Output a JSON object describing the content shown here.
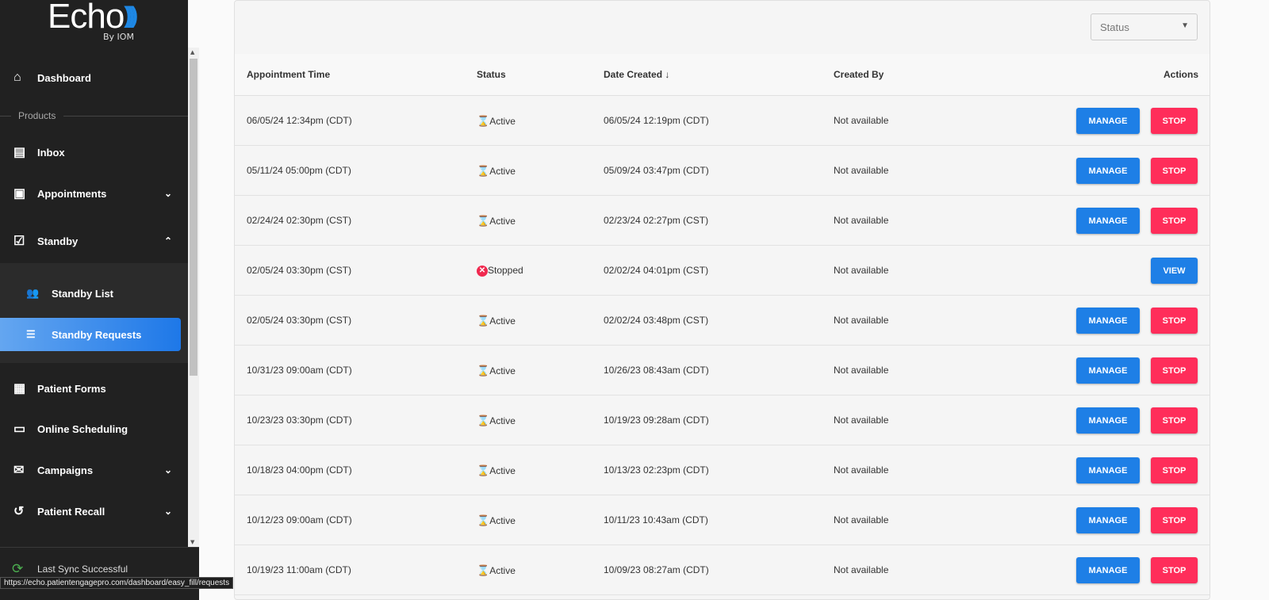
{
  "brand": {
    "name": "Echo",
    "sub": "By IOM"
  },
  "sidebar": {
    "dashboard": "Dashboard",
    "products_label": "Products",
    "items": [
      {
        "label": "Inbox"
      },
      {
        "label": "Appointments"
      },
      {
        "label": "Standby"
      },
      {
        "label": "Patient Forms"
      },
      {
        "label": "Online Scheduling"
      },
      {
        "label": "Campaigns"
      },
      {
        "label": "Patient Recall"
      }
    ],
    "sub": [
      {
        "label": "Standby List"
      },
      {
        "label": "Standby Requests",
        "active": true
      }
    ],
    "sync": "Last Sync Successful"
  },
  "tooltip": "https://echo.patientengagepro.com/dashboard/easy_fill/requests",
  "filter": {
    "status_placeholder": "Status"
  },
  "table": {
    "headers": {
      "appt": "Appointment Time",
      "status": "Status",
      "created": "Date Created",
      "by": "Created By",
      "actions": "Actions"
    },
    "manage_label": "MANAGE",
    "stop_label": "STOP",
    "view_label": "VIEW",
    "rows": [
      {
        "appt": "06/05/24 12:34pm (CDT)",
        "status": "Active",
        "created": "06/05/24 12:19pm (CDT)",
        "by": "Not available"
      },
      {
        "appt": "05/11/24 05:00pm (CDT)",
        "status": "Active",
        "created": "05/09/24 03:47pm (CDT)",
        "by": "Not available"
      },
      {
        "appt": "02/24/24 02:30pm (CST)",
        "status": "Active",
        "created": "02/23/24 02:27pm (CST)",
        "by": "Not available"
      },
      {
        "appt": "02/05/24 03:30pm (CST)",
        "status": "Stopped",
        "created": "02/02/24 04:01pm (CST)",
        "by": "Not available"
      },
      {
        "appt": "02/05/24 03:30pm (CST)",
        "status": "Active",
        "created": "02/02/24 03:48pm (CST)",
        "by": "Not available"
      },
      {
        "appt": "10/31/23 09:00am (CDT)",
        "status": "Active",
        "created": "10/26/23 08:43am (CDT)",
        "by": "Not available"
      },
      {
        "appt": "10/23/23 03:30pm (CDT)",
        "status": "Active",
        "created": "10/19/23 09:28am (CDT)",
        "by": "Not available"
      },
      {
        "appt": "10/18/23 04:00pm (CDT)",
        "status": "Active",
        "created": "10/13/23 02:23pm (CDT)",
        "by": "Not available"
      },
      {
        "appt": "10/12/23 09:00am (CDT)",
        "status": "Active",
        "created": "10/11/23 10:43am (CDT)",
        "by": "Not available"
      },
      {
        "appt": "10/19/23 11:00am (CDT)",
        "status": "Active",
        "created": "10/09/23 08:27am (CDT)",
        "by": "Not available"
      }
    ]
  }
}
